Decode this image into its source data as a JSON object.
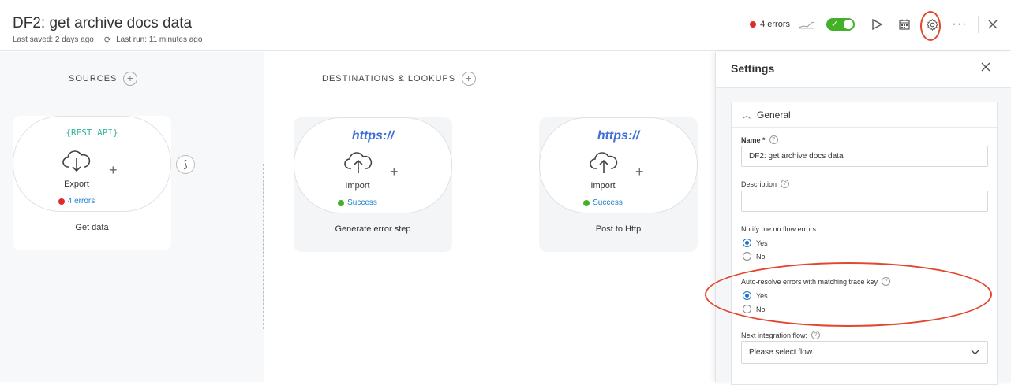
{
  "header": {
    "title": "DF2: get archive docs data",
    "last_saved": "Last saved: 2 days ago",
    "last_run": "Last run: 11 minutes ago",
    "errors_label": "4 errors",
    "toggle_on": true,
    "colors": {
      "error": "#e02b2b",
      "toggle": "#43b02a",
      "highlight": "#e2472d"
    }
  },
  "canvas": {
    "sources_label": "SOURCES",
    "destinations_label": "DESTINATIONS & LOOKUPS",
    "steps": [
      {
        "app": "{REST API}",
        "type": "Export",
        "status": "4 errors",
        "status_kind": "error",
        "name": "Get data"
      },
      {
        "app": "https://",
        "type": "Import",
        "status": "Success",
        "status_kind": "success",
        "name": "Generate error step"
      },
      {
        "app": "https://",
        "type": "Import",
        "status": "Success",
        "status_kind": "success",
        "name": "Post to Http"
      }
    ]
  },
  "settings": {
    "title": "Settings",
    "section_label": "General",
    "name_label": "Name *",
    "name_value": "DF2: get archive docs data",
    "description_label": "Description",
    "description_value": "",
    "notify_label": "Notify me on flow errors",
    "notify_options": [
      "Yes",
      "No"
    ],
    "notify_selected": "Yes",
    "autoresolve_label": "Auto-resolve errors with matching trace key",
    "autoresolve_options": [
      "Yes",
      "No"
    ],
    "autoresolve_selected": "Yes",
    "next_flow_label": "Next integration flow:",
    "next_flow_value": "Please select flow"
  }
}
